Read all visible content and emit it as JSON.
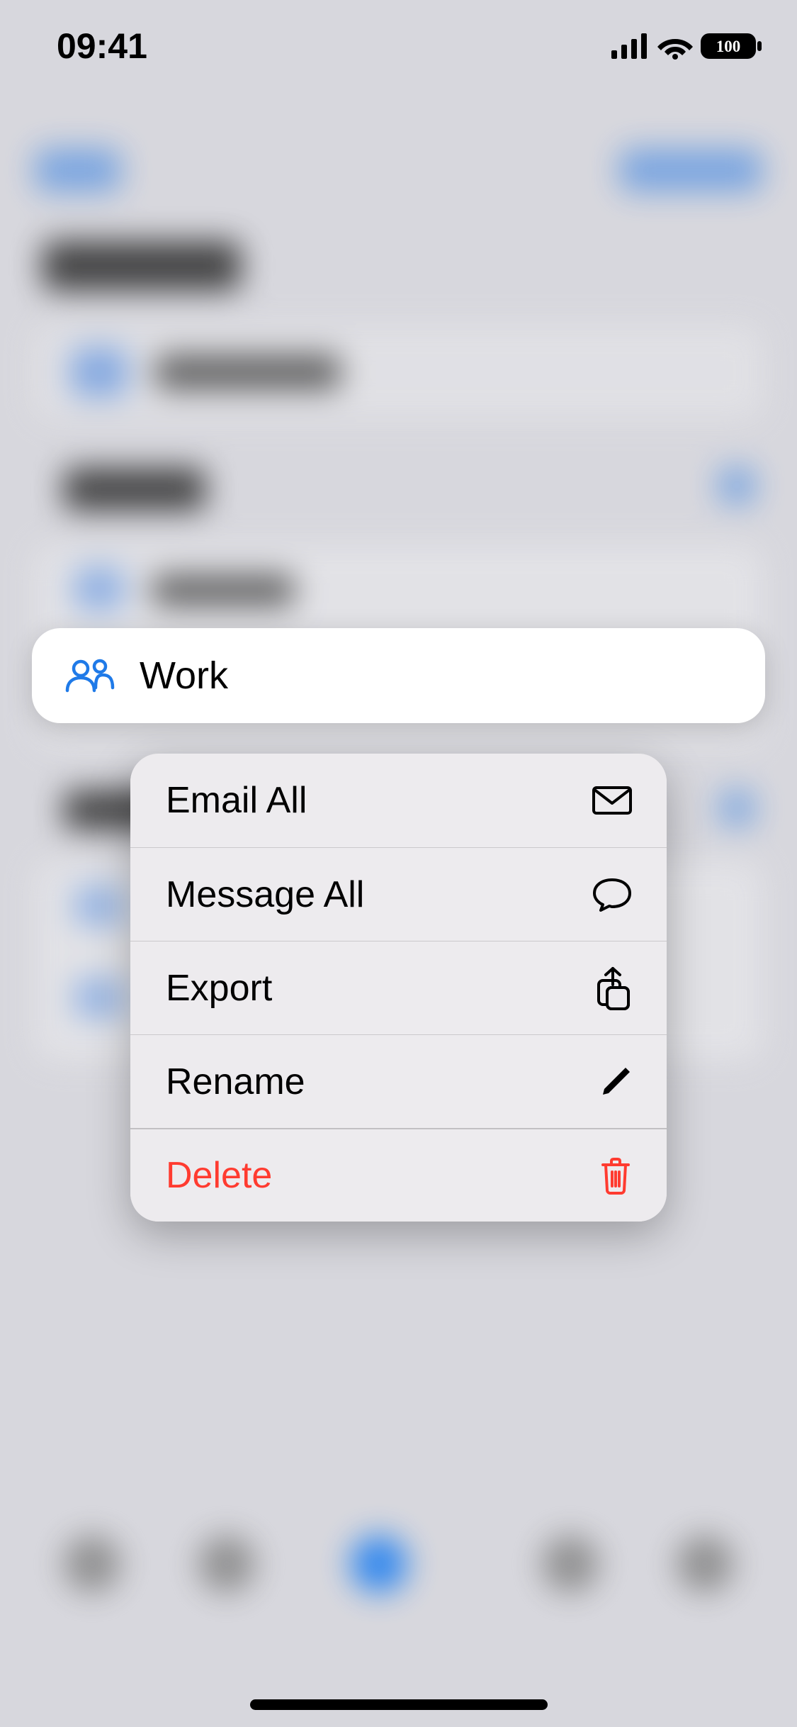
{
  "status": {
    "time": "09:41",
    "battery": "100"
  },
  "selected": {
    "label": "Work"
  },
  "menu": {
    "email_all": "Email All",
    "message_all": "Message All",
    "export": "Export",
    "rename": "Rename",
    "delete": "Delete"
  }
}
